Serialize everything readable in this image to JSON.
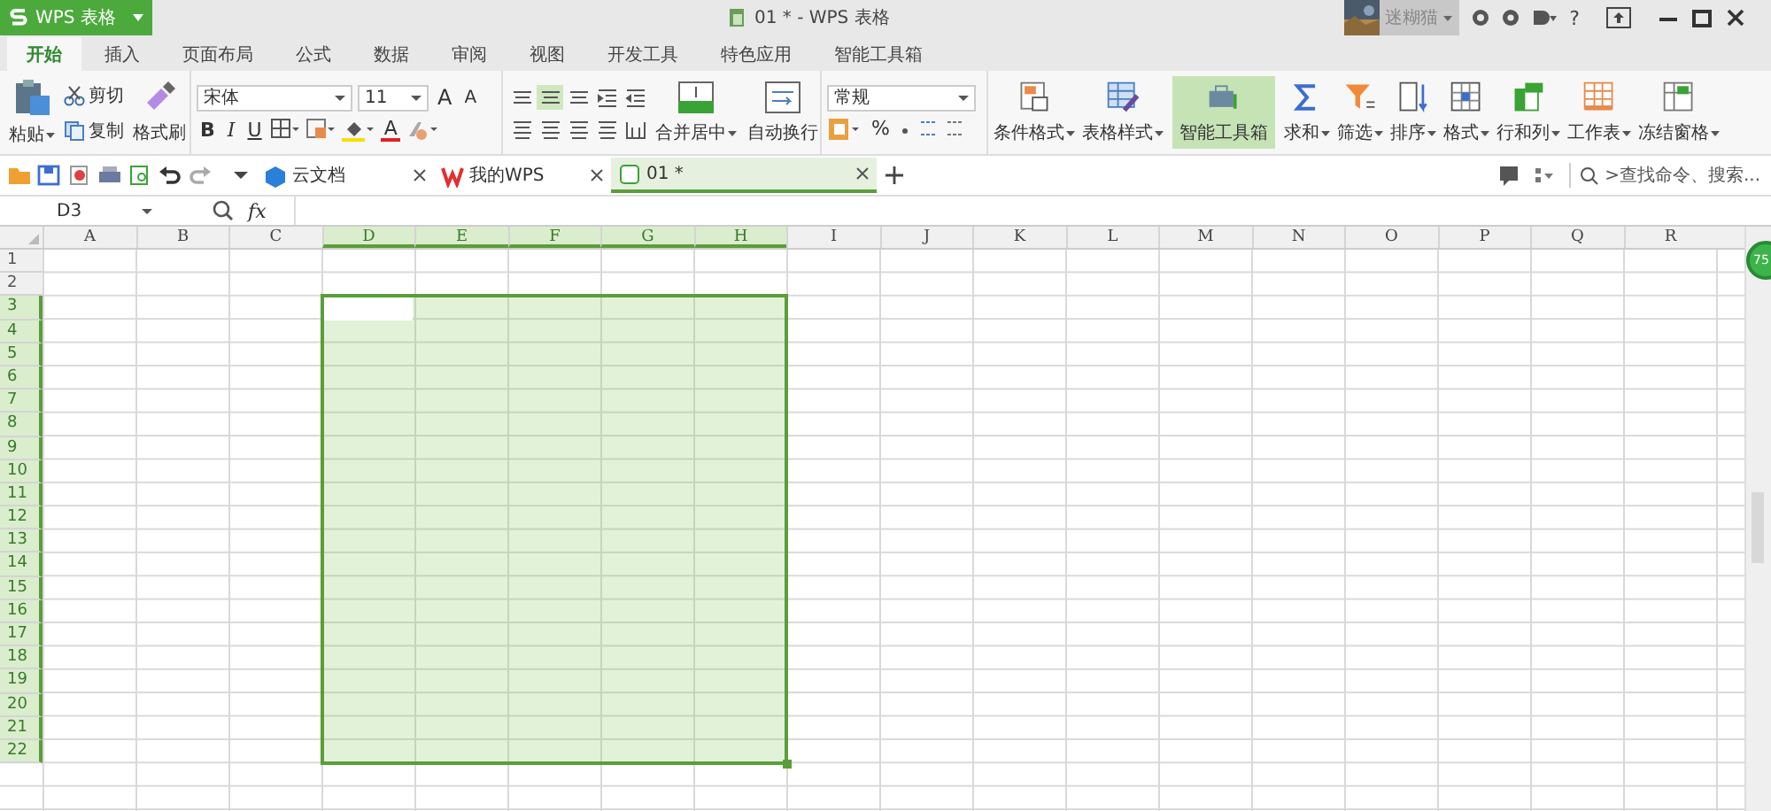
{
  "title_bar": {
    "app_button": "WPS 表格",
    "title": "01 * - WPS 表格",
    "user": "迷糊猫",
    "help": "?"
  },
  "menu_tabs": [
    {
      "label": "开始",
      "selected": true
    },
    {
      "label": "插入",
      "selected": false
    },
    {
      "label": "页面布局",
      "selected": false
    },
    {
      "label": "公式",
      "selected": false
    },
    {
      "label": "数据",
      "selected": false
    },
    {
      "label": "审阅",
      "selected": false
    },
    {
      "label": "视图",
      "selected": false
    },
    {
      "label": "开发工具",
      "selected": false
    },
    {
      "label": "特色应用",
      "selected": false
    },
    {
      "label": "智能工具箱",
      "selected": false
    }
  ],
  "ribbon": {
    "clipboard": {
      "paste": "粘贴",
      "cut": "剪切",
      "copy": "复制",
      "format_painter": "格式刷"
    },
    "font": {
      "name": "宋体",
      "size": "11",
      "grow": "A",
      "shrink": "A",
      "bold": "B",
      "italic": "I",
      "underline": "U",
      "font_color": "A"
    },
    "alignment": {
      "merge": "合并居中",
      "wrap": "自动换行"
    },
    "number": {
      "format": "常规",
      "percent": "%"
    },
    "tools": [
      {
        "label": "条件格式",
        "dropdown": true,
        "active": false
      },
      {
        "label": "表格样式",
        "dropdown": true,
        "active": false
      },
      {
        "label": "智能工具箱",
        "dropdown": false,
        "active": true
      },
      {
        "label": "求和",
        "dropdown": true,
        "active": false
      },
      {
        "label": "筛选",
        "dropdown": true,
        "active": false
      },
      {
        "label": "排序",
        "dropdown": true,
        "active": false
      },
      {
        "label": "格式",
        "dropdown": true,
        "active": false
      },
      {
        "label": "行和列",
        "dropdown": true,
        "active": false
      },
      {
        "label": "工作表",
        "dropdown": true,
        "active": false
      },
      {
        "label": "冻结窗格",
        "dropdown": true,
        "active": false
      }
    ]
  },
  "doc_tabs": [
    {
      "label": "云文档",
      "selected": false
    },
    {
      "label": "我的WPS",
      "selected": false
    },
    {
      "label": "01 *",
      "selected": true
    }
  ],
  "search": {
    "placeholder": ">查找命令、搜索..."
  },
  "formula_bar": {
    "name_box": "D3",
    "fx": "fx"
  },
  "sheet": {
    "columns": [
      {
        "label": "A",
        "selected": false
      },
      {
        "label": "B",
        "selected": false
      },
      {
        "label": "C",
        "selected": false
      },
      {
        "label": "D",
        "selected": true
      },
      {
        "label": "E",
        "selected": true
      },
      {
        "label": "F",
        "selected": true
      },
      {
        "label": "G",
        "selected": true
      },
      {
        "label": "H",
        "selected": true
      },
      {
        "label": "I",
        "selected": false
      },
      {
        "label": "J",
        "selected": false
      },
      {
        "label": "K",
        "selected": false
      },
      {
        "label": "L",
        "selected": false
      },
      {
        "label": "M",
        "selected": false
      },
      {
        "label": "N",
        "selected": false
      },
      {
        "label": "O",
        "selected": false
      },
      {
        "label": "P",
        "selected": false
      },
      {
        "label": "Q",
        "selected": false
      },
      {
        "label": "R",
        "selected": false
      }
    ],
    "rows": [
      {
        "label": "1",
        "selected": false
      },
      {
        "label": "2",
        "selected": false
      },
      {
        "label": "3",
        "selected": true
      },
      {
        "label": "4",
        "selected": true
      },
      {
        "label": "5",
        "selected": true
      },
      {
        "label": "6",
        "selected": true
      },
      {
        "label": "7",
        "selected": true
      },
      {
        "label": "8",
        "selected": true
      },
      {
        "label": "9",
        "selected": true
      },
      {
        "label": "10",
        "selected": true
      },
      {
        "label": "11",
        "selected": true
      },
      {
        "label": "12",
        "selected": true
      },
      {
        "label": "13",
        "selected": true
      },
      {
        "label": "14",
        "selected": true
      },
      {
        "label": "15",
        "selected": true
      },
      {
        "label": "16",
        "selected": true
      },
      {
        "label": "17",
        "selected": true
      },
      {
        "label": "18",
        "selected": true
      },
      {
        "label": "19",
        "selected": true
      },
      {
        "label": "20",
        "selected": true
      },
      {
        "label": "21",
        "selected": true
      },
      {
        "label": "22",
        "selected": true
      }
    ]
  },
  "float_badge": "75"
}
